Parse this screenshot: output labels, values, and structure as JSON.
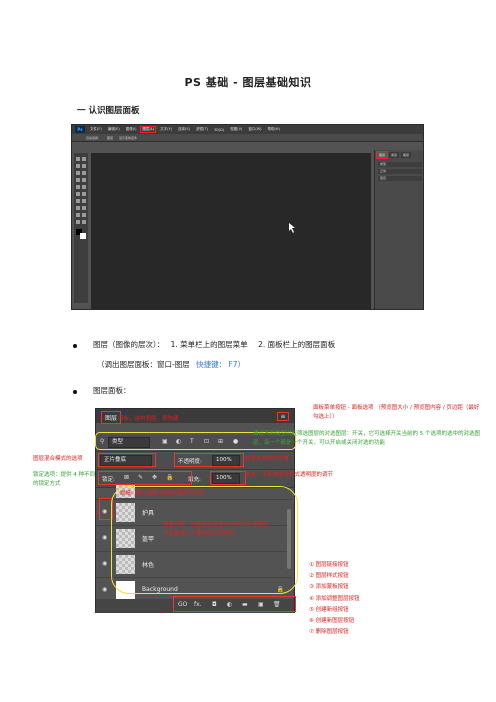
{
  "title": "PS 基础 - 图层基础知识",
  "section1": "一 认识图层面板",
  "ps_window": {
    "logo": "Ps",
    "menu": [
      "文件(F)",
      "编辑(E)",
      "图像(I)",
      "图层(L)",
      "文字(Y)",
      "选择(S)",
      "滤镜(T)",
      "3D(D)",
      "视图(V)",
      "窗口(W)",
      "帮助(H)"
    ],
    "highlighted_menu": "图层(L)",
    "options": [
      "自动选择：",
      "图层",
      "显示变换控件"
    ],
    "panel_tabs": [
      "图层",
      "通道",
      "路径"
    ],
    "panel_rows": [
      "类型",
      "正常",
      "锁定:"
    ]
  },
  "bullet1": {
    "line1_parts": [
      "图层（图像的层次）：",
      "1. 菜单栏上的图层菜单",
      "2. 面板栏上的图层面板"
    ],
    "line2": "（调出图层面板：窗口-图层",
    "shortcut": "快捷键： F7）"
  },
  "bullet2": "图层面板：",
  "layers_panel": {
    "tab": "图层",
    "menu_icon": "≡",
    "filter_label": "类型",
    "blend_mode": "正片叠底",
    "opacity_label": "不透明度:",
    "opacity_value": "100%",
    "lock_label": "锁定:",
    "fill_label": "填充:",
    "fill_value": "100%",
    "layers": [
      {
        "name": "护具",
        "eye": "◉"
      },
      {
        "name": "盔甲",
        "eye": "◉"
      },
      {
        "name": "林色",
        "eye": "◉"
      },
      {
        "name": "Background",
        "eye": "◉"
      }
    ],
    "bottom_icons": [
      "GO",
      "fx.",
      "◘",
      "◐",
      "▬",
      "▣",
      "🗑"
    ]
  },
  "annotations": {
    "tab_note": "面板，选中图层，按快捷",
    "menu_note": "面板菜单按钮 - 面板选项 （预览图大小 / 预览图内容 / 页边距（最好勾选上））",
    "filter_note": "通过不同类型对应筛选图层的对选图层：开关，它可选择开关当前的 5 个选项的选中的对选图层，每一个都是一个开关，可以开启或关闭对选的功能",
    "blend_note": "图层混合模式的选项",
    "opacity_note": "图层透明度的设置",
    "lock_note": "锁定选项：提供 4 种不同的锁定方式",
    "fill_note": "填充：不影响图层样式透明度的调节",
    "layer_hint": "眼睛: 显示/隐藏 图层的显示可见性",
    "list_note": "图层列表：在图层列表里可以列出所有图层，并且是独上下叠加的次序排列"
  },
  "bottom_list": [
    "① 图层链接按钮",
    "② 图层样式按钮",
    "③ 添加蒙板按钮",
    "④ 添加调整图层按钮",
    "⑤ 创建新组按钮",
    "⑥ 创建新图层按钮",
    "⑦ 删除图层按钮"
  ]
}
